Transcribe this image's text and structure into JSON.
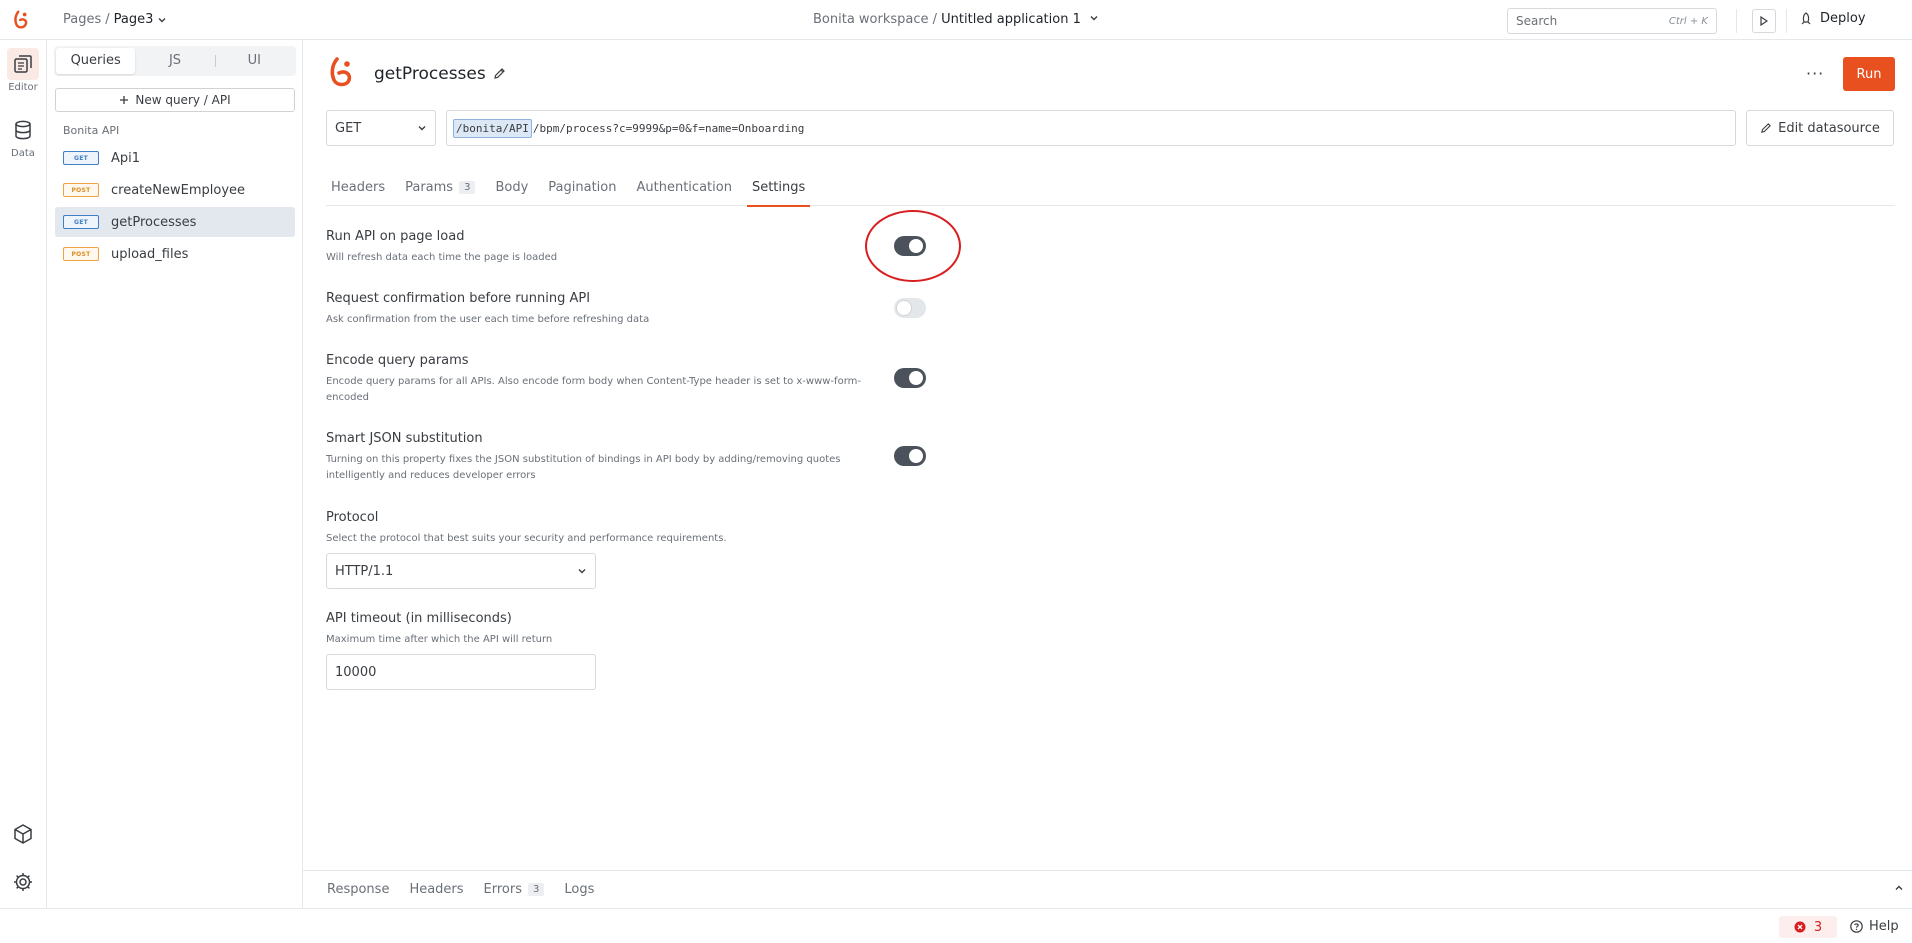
{
  "topbar": {
    "breadcrumb_root": "Pages",
    "breadcrumb_sep": "/",
    "page_name": "Page3",
    "workspace": "Bonita workspace /",
    "app_name": "Untitled application 1",
    "search_placeholder": "Search",
    "search_shortcut": "Ctrl + K",
    "deploy_label": "Deploy"
  },
  "rail": {
    "editor_label": "Editor",
    "data_label": "Data"
  },
  "panel": {
    "tabs": [
      "Queries",
      "JS",
      "UI"
    ],
    "new_query_label": "New query / API",
    "group_label": "Bonita API",
    "queries": [
      {
        "method": "GET",
        "name": "Api1"
      },
      {
        "method": "POST",
        "name": "createNewEmployee"
      },
      {
        "method": "GET",
        "name": "getProcesses"
      },
      {
        "method": "POST",
        "name": "upload_files"
      }
    ]
  },
  "query": {
    "name": "getProcesses",
    "more_label": "···",
    "run_label": "Run",
    "method": "GET",
    "url_datasource": "/bonita/API",
    "url_path": "/bpm/process?c=9999&p=0&f=name=Onboarding",
    "edit_datasource_label": "Edit datasource"
  },
  "tabs": [
    {
      "label": "Headers"
    },
    {
      "label": "Params",
      "count": "3"
    },
    {
      "label": "Body"
    },
    {
      "label": "Pagination"
    },
    {
      "label": "Authentication"
    },
    {
      "label": "Settings"
    }
  ],
  "settings": {
    "run_on_load": {
      "title": "Run API on page load",
      "desc": "Will refresh data each time the page is loaded",
      "enabled": true
    },
    "confirm": {
      "title": "Request confirmation before running API",
      "desc": "Ask confirmation from the user each time before refreshing data",
      "enabled": false
    },
    "encode": {
      "title": "Encode query params",
      "desc": "Encode query params for all APIs. Also encode form body when Content-Type header is set to x-www-form-encoded",
      "enabled": true
    },
    "smart_json": {
      "title": "Smart JSON substitution",
      "desc": "Turning on this property fixes the JSON substitution of bindings in API body by adding/removing quotes intelligently and reduces developer errors",
      "enabled": true
    },
    "protocol": {
      "title": "Protocol",
      "desc": "Select the protocol that best suits your security and performance requirements.",
      "value": "HTTP/1.1"
    },
    "timeout": {
      "title": "API timeout (in milliseconds)",
      "desc": "Maximum time after which the API will return",
      "value": "10000"
    }
  },
  "response_tabs": [
    {
      "label": "Response"
    },
    {
      "label": "Headers"
    },
    {
      "label": "Errors",
      "count": "3"
    },
    {
      "label": "Logs"
    }
  ],
  "footer": {
    "error_count": "3",
    "help_label": "Help"
  },
  "colors": {
    "accent": "#e8501f",
    "toggle_on": "#4b525b",
    "annotation": "#d81e1e"
  }
}
